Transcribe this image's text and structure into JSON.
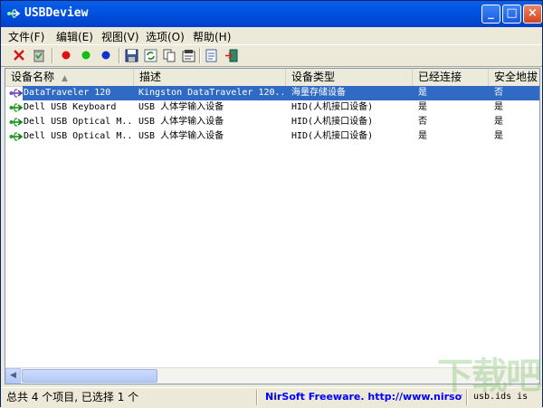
{
  "window": {
    "title": "USBDeview"
  },
  "titlebar_buttons": {
    "minimize": "_",
    "maximize": "□",
    "close": "×"
  },
  "menu": [
    {
      "label": "文件(F)"
    },
    {
      "label": "编辑(E)"
    },
    {
      "label": "视图(V)"
    },
    {
      "label": "选项(O)"
    },
    {
      "label": "帮助(H)"
    }
  ],
  "toolbar": {
    "icons": [
      "delete-icon",
      "uninstall-icon",
      "red-dot-icon",
      "green-dot-icon",
      "blue-dot-icon",
      "save-icon",
      "refresh-icon",
      "copy-icon",
      "properties-icon",
      "report-icon",
      "exit-icon"
    ]
  },
  "columns": [
    {
      "label": "设备名称"
    },
    {
      "label": "描述"
    },
    {
      "label": "设备类型"
    },
    {
      "label": "已经连接"
    },
    {
      "label": "安全地拔"
    }
  ],
  "rows": [
    {
      "name": "DataTraveler 120",
      "description": "Kingston DataTraveler 120...",
      "type": "海量存储设备",
      "connected": "是",
      "safe_remove": "否",
      "selected": true
    },
    {
      "name": "Dell USB Keyboard",
      "description": "USB 人体学输入设备",
      "type": "HID(人机接口设备)",
      "connected": "是",
      "safe_remove": "是",
      "selected": false
    },
    {
      "name": "Dell USB Optical M...",
      "description": "USB 人体学输入设备",
      "type": "HID(人机接口设备)",
      "connected": "否",
      "safe_remove": "是",
      "selected": false
    },
    {
      "name": "Dell USB Optical M...",
      "description": "USB 人体学输入设备",
      "type": "HID(人机接口设备)",
      "connected": "是",
      "safe_remove": "是",
      "selected": false
    }
  ],
  "status": {
    "count": "总共 4 个项目, 已选择 1 个",
    "nirsoft": "NirSoft Freeware.  http://www.nirsoft.net",
    "ids": "usb.ids is"
  },
  "watermark": "下载吧",
  "colors": {
    "titlebar": "#0053e1",
    "selection": "#316ac5",
    "link": "#0000ff"
  }
}
